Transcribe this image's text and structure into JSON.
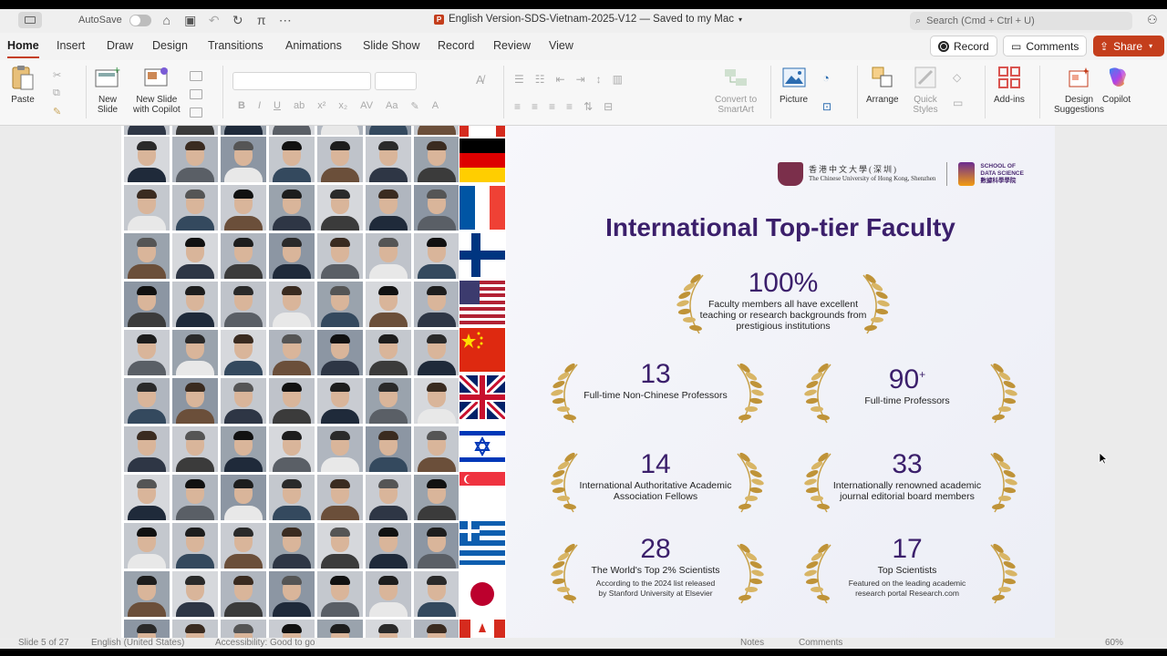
{
  "titlebar": {
    "autosave_label": "AutoSave",
    "document_title": "English Version-SDS-Vietnam-2025-V12 — Saved to my Mac",
    "search_placeholder": "Search (Cmd + Ctrl + U)"
  },
  "tabs": [
    "Home",
    "Insert",
    "Draw",
    "Design",
    "Transitions",
    "Animations",
    "Slide Show",
    "Record",
    "Review",
    "View"
  ],
  "actions": {
    "record": "Record",
    "comments": "Comments",
    "share": "Share"
  },
  "ribbon": {
    "paste": "Paste",
    "new_slide_1": "New",
    "new_slide_2": "Slide",
    "new_slide_copilot_1": "New Slide",
    "new_slide_copilot_2": "with Copilot",
    "convert_1": "Convert to",
    "convert_2": "SmartArt",
    "picture": "Picture",
    "arrange": "Arrange",
    "quick_styles_1": "Quick",
    "quick_styles_2": "Styles",
    "addins": "Add-ins",
    "design_suggestions_1": "Design",
    "design_suggestions_2": "Suggestions",
    "copilot": "Copilot"
  },
  "slide": {
    "title": "International Top-tier Faculty",
    "logo_cn": "香港中文大學(深圳)",
    "logo_en": "The Chinese University of Hong Kong, Shenzhen",
    "sds_line1": "SCHOOL OF",
    "sds_line2": "DATA SCIENCE",
    "sds_line3": "數據科學學院",
    "stats": [
      {
        "num": "100%",
        "desc1": "Faculty members all have excellent",
        "desc2": "teaching or research backgrounds from",
        "desc3": "prestigious institutions"
      },
      {
        "num": "13",
        "desc1": "Full-time Non-Chinese Professors"
      },
      {
        "num": "90",
        "plus": "+",
        "desc1": "Full-time Professors"
      },
      {
        "num": "14",
        "desc1": "International Authoritative Academic",
        "desc2": "Association Fellows"
      },
      {
        "num": "33",
        "desc1": "Internationally renowned academic",
        "desc2": "journal editorial board members"
      },
      {
        "num": "28",
        "desc1": "The World's Top 2% Scientists",
        "sub1": "According to the 2024 list released",
        "sub2": "by Stanford University at Elsevier"
      },
      {
        "num": "17",
        "desc1": "Top Scientists",
        "sub1": "Featured on the leading academic",
        "sub2": "research portal Research.com"
      }
    ]
  },
  "statusbar": {
    "slide_info": "Slide 5 of 27",
    "language": "English (United States)",
    "accessibility": "Accessibility: Good to go",
    "notes": "Notes",
    "comments": "Comments",
    "zoom": "60%"
  }
}
